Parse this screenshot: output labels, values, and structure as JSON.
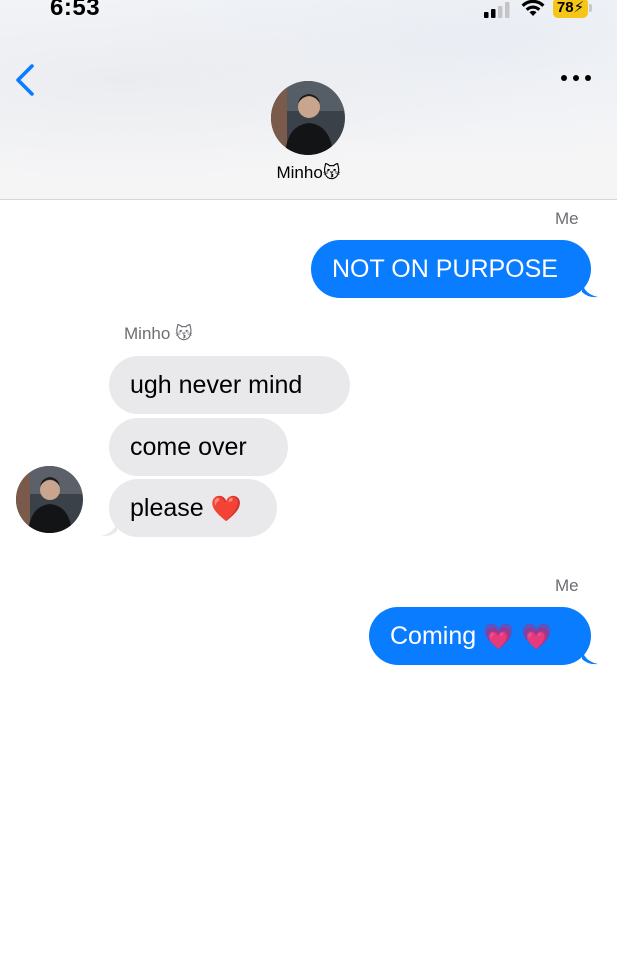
{
  "status_bar": {
    "time": "6:53",
    "battery": "78"
  },
  "header": {
    "contact_name": "Minho",
    "contact_emoji": "😽"
  },
  "messages": [
    {
      "sender_label": "Me",
      "text": "NOT ON PURPOSE"
    },
    {
      "sender_label": "Minho 😽",
      "text": "ugh never mind"
    },
    {
      "text": "come over"
    },
    {
      "text": "please",
      "emoji": "❤️"
    },
    {
      "sender_label": "Me",
      "text": "Coming",
      "emoji": "💗 💗"
    }
  ],
  "colors": {
    "me_bubble": "#0a7cff",
    "them_bubble": "#e9e9eb",
    "accent": "#0a7cff",
    "battery": "#f5c518"
  },
  "icons": {
    "back": "chevron-left-icon",
    "more": "ellipsis-icon",
    "signal": "signal-icon",
    "wifi": "wifi-icon"
  }
}
